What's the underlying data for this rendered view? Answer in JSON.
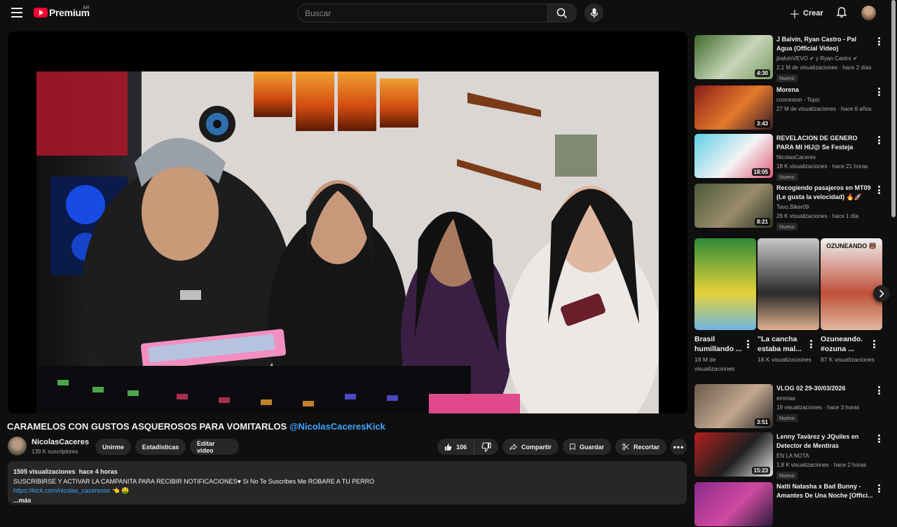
{
  "header": {
    "logo_text": "Premium",
    "region": "AR",
    "search_placeholder": "Buscar",
    "create_label": "Crear",
    "icons": [
      "menu-icon",
      "search-icon",
      "mic-icon",
      "plus-icon",
      "bell-icon"
    ]
  },
  "video": {
    "title": "CARAMELOS CON GUSTOS ASQUEROSOS PARA VOMITARLOS",
    "title_mention": "@NicolasCaceresKick",
    "channel": "NicolasCaceres",
    "subscribers": "139 K suscriptores",
    "join_label": "Unirme",
    "stats_label": "Estadísticas",
    "edit_label": "Editar video",
    "likes": "106",
    "share_label": "Compartir",
    "save_label": "Guardar",
    "clip_label": "Recortar"
  },
  "description": {
    "views": "1505 visualizaciones",
    "time": "hace 4 horas",
    "line1": "SUSCRIBIRSE Y ACTIVAR LA CAMPANITA PARA RECIBIR NOTIFICACIONES♥  Si No Te Suscribes Me ROBARE A TU PERRO",
    "link": "https://kick.com/nicolas_caceresss",
    "link_emoji": " 👈 🤑",
    "more": "...más"
  },
  "sidebar": [
    {
      "title": "J Balvin, Ryan Castro - Pal Agua (Official Video)",
      "channel": "jbalvinVEVO ✔ y Ryan Castro ✔",
      "meta": "2,1 M de visualizaciones · hace 2 días",
      "badge": "Nuevo",
      "duration": "4:30",
      "colors": [
        "#3f6b2c",
        "#c7d6b8",
        "#7a9a64"
      ]
    },
    {
      "title": "Morena",
      "channel": "connexion - Topic",
      "meta": "27 M de visualizaciones · hace 6 años",
      "badge": "",
      "duration": "3:43",
      "colors": [
        "#8b1d1a",
        "#e27a2a",
        "#3a1a2a"
      ]
    },
    {
      "title": "REVELACION DE GENERO PARA MI HIJ@ Se Festeja Comiendo...",
      "channel": "NicolasCaceres",
      "meta": "18 K visualizaciones · hace 21 horas",
      "badge": "Nuevo",
      "duration": "18:05",
      "colors": [
        "#5fd0e8",
        "#f3f3f3",
        "#e05a7a"
      ]
    },
    {
      "title": "Recogiendo pasajeros en MT09 (Le gusta la velocidad) 🔥🚀",
      "channel": "Tavo.Biker09",
      "meta": "26 K visualizaciones · hace 1 día",
      "badge": "Nuevo",
      "duration": "8:21",
      "colors": [
        "#4b5a3a",
        "#9a8c6a",
        "#2c3325"
      ]
    },
    {
      "title": "VLOG 02 29-30/03/2026",
      "channel": "emmaa",
      "meta": "19 visualizaciones · hace 3 horas",
      "badge": "Nuevo",
      "duration": "3:51",
      "colors": [
        "#6a5a4a",
        "#c4a890",
        "#2a2a2a"
      ]
    },
    {
      "title": "Lenny Tavárez y JQuiles en Detector de Mentiras",
      "channel": "EN LA NOTA",
      "meta": "1,8 K visualizaciones · hace 2 horas",
      "badge": "Nuevo",
      "duration": "15:23",
      "colors": [
        "#b21e1e",
        "#202020",
        "#e8e8e8"
      ]
    },
    {
      "title": "Natti Natasha x Bad Bunny - Amantes De Una Noche [Offici...",
      "channel": "",
      "meta": "",
      "badge": "",
      "duration": "",
      "colors": [
        "#8a2a8a",
        "#d04aa0",
        "#2a1a3a"
      ]
    }
  ],
  "shorts": [
    {
      "title": "Brasil humillando ...",
      "views": "18 M de visualizaciones",
      "colors": [
        "#2f8a3a",
        "#e6d23a",
        "#6fb4e0"
      ]
    },
    {
      "title": "\"La cancha estaba mal...",
      "views": "18 K visualizaciones",
      "colors": [
        "#c8c8c8",
        "#2a2a2a",
        "#e0b090"
      ]
    },
    {
      "title": "Ozuneando. #ozuna ...",
      "views": "87 K visualizaciones",
      "overlay": "OZUNEANDO 🐻",
      "colors": [
        "#efefef",
        "#c0503a",
        "#e0b8a0"
      ]
    }
  ]
}
